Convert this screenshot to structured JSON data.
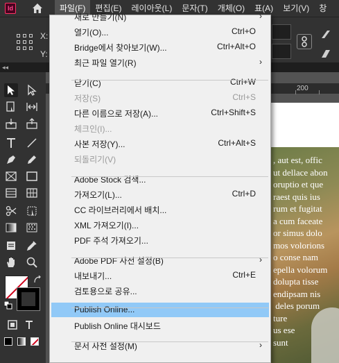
{
  "app": {
    "logo_text": "Id"
  },
  "menubar": {
    "items": [
      {
        "label": "파일(F)",
        "active": true
      },
      {
        "label": "편집(E)",
        "active": false
      },
      {
        "label": "레이아웃(L)",
        "active": false
      },
      {
        "label": "문자(T)",
        "active": false
      },
      {
        "label": "개체(O)",
        "active": false
      },
      {
        "label": "표(A)",
        "active": false
      },
      {
        "label": "보기(V)",
        "active": false
      },
      {
        "label": "창",
        "active": false
      }
    ]
  },
  "controlbar": {
    "x_label": "X:",
    "y_label": "Y:"
  },
  "ruler": {
    "label": "200"
  },
  "file_menu": {
    "items": [
      {
        "label": "새로 만들기(N)",
        "shortcut": "",
        "submenu": true,
        "disabled": false
      },
      {
        "label": "열기(O)...",
        "shortcut": "Ctrl+O",
        "submenu": false,
        "disabled": false
      },
      {
        "label": "Bridge에서 찾아보기(W)...",
        "shortcut": "Ctrl+Alt+O",
        "submenu": false,
        "disabled": false
      },
      {
        "label": "최근 파일 열기(R)",
        "shortcut": "",
        "submenu": true,
        "disabled": false
      },
      {
        "label": "닫기(C)",
        "shortcut": "Ctrl+W",
        "submenu": false,
        "disabled": false
      },
      {
        "label": "저장(S)",
        "shortcut": "Ctrl+S",
        "submenu": false,
        "disabled": true
      },
      {
        "label": "다른 이름으로 저장(A)...",
        "shortcut": "Ctrl+Shift+S",
        "submenu": false,
        "disabled": false
      },
      {
        "label": "체크인(I)...",
        "shortcut": "",
        "submenu": false,
        "disabled": true
      },
      {
        "label": "사본 저장(Y)...",
        "shortcut": "Ctrl+Alt+S",
        "submenu": false,
        "disabled": false
      },
      {
        "label": "되돌리기(V)",
        "shortcut": "",
        "submenu": false,
        "disabled": true
      },
      {
        "label": "Adobe Stock 검색...",
        "shortcut": "",
        "submenu": false,
        "disabled": false
      },
      {
        "label": "가져오기(L)...",
        "shortcut": "Ctrl+D",
        "submenu": false,
        "disabled": false
      },
      {
        "label": "CC 라이브러리에서 배치...",
        "shortcut": "",
        "submenu": false,
        "disabled": false
      },
      {
        "label": "XML 가져오기(I)...",
        "shortcut": "",
        "submenu": false,
        "disabled": false
      },
      {
        "label": "PDF 주석 가져오기...",
        "shortcut": "",
        "submenu": false,
        "disabled": false
      },
      {
        "label": "Adobe PDF 사전 설정(B)",
        "shortcut": "",
        "submenu": true,
        "disabled": false
      },
      {
        "label": "내보내기...",
        "shortcut": "Ctrl+E",
        "submenu": false,
        "disabled": false
      },
      {
        "label": "검토용으로 공유...",
        "shortcut": "",
        "submenu": false,
        "disabled": false
      },
      {
        "label": "Publish Online...",
        "shortcut": "",
        "submenu": false,
        "disabled": false,
        "highlighted": true
      },
      {
        "label": "Publish Online 대시보드",
        "shortcut": "",
        "submenu": false,
        "disabled": false
      },
      {
        "label": "문서 사전 설정(M)",
        "shortcut": "",
        "submenu": true,
        "disabled": false
      }
    ]
  },
  "document_text": [
    ", aut est, offic",
    "ut dellace abon",
    "oruptio et que",
    "raest quis ius",
    "rum et fugitat",
    "a cum faceate",
    "or simus dolo",
    "mos volorions",
    "o conse nam",
    "epella volorum",
    "dolupta tisse",
    "endipsam nis",
    " deles porum",
    "ture",
    "us ese",
    "sunt"
  ],
  "colors": {
    "menubar_bg": "#323232",
    "menu_bg": "#f0f0f0",
    "highlight": "#91c9f7",
    "disabled_text": "#9a9a9a",
    "stroke_swatch": "#d0021b"
  }
}
